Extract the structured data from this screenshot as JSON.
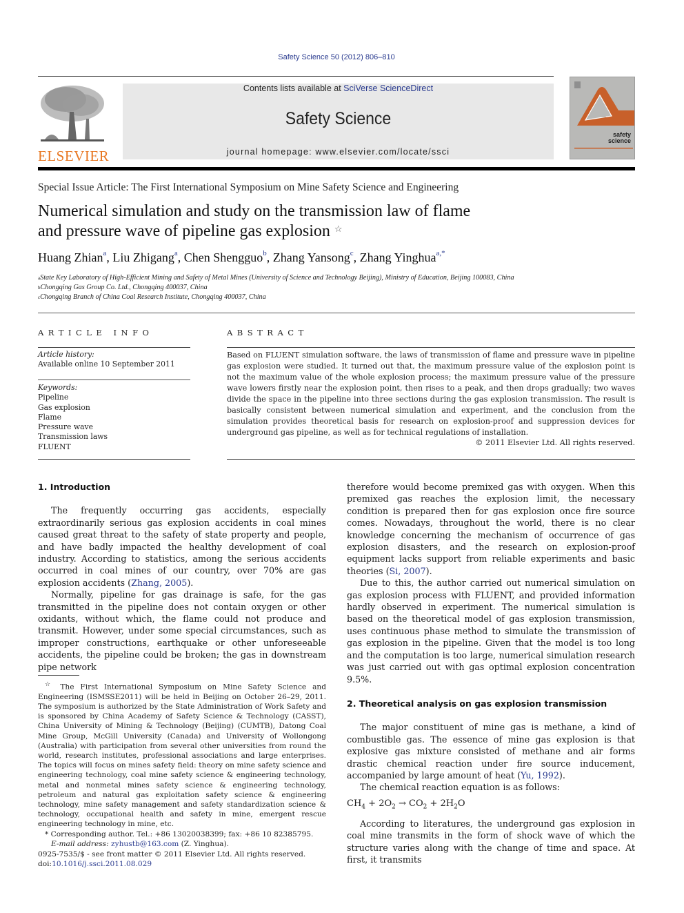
{
  "citation": "Safety Science 50 (2012) 806–810",
  "publisher": {
    "logo_text": "ELSEVIER",
    "brand_color": "#e87722"
  },
  "banner": {
    "contents_prefix": "Contents lists available at ",
    "contents_link": "SciVerse ScienceDirect",
    "journal_title": "Safety Science",
    "homepage_prefix": "journal homepage: ",
    "homepage_url": "www.elsevier.com/locate/ssci"
  },
  "cover": {
    "line1": "safety",
    "line2": "science",
    "accent_color": "#c8602a"
  },
  "article": {
    "special_issue": "Special Issue Article: The First International Symposium on Mine Safety Science and Engineering",
    "title_line1": "Numerical simulation and study on the transmission law of flame",
    "title_line2": "and pressure wave of pipeline gas explosion",
    "title_mark": "☆",
    "authors": [
      {
        "name": "Huang Zhian",
        "sup": "a"
      },
      {
        "name": "Liu Zhigang",
        "sup": "a"
      },
      {
        "name": "Chen Shengguo",
        "sup": "b"
      },
      {
        "name": "Zhang Yansong",
        "sup": "c"
      },
      {
        "name": "Zhang Yinghua",
        "sup": "a,*"
      }
    ],
    "affiliations": [
      {
        "sup": "a",
        "text": "State Key Laboratory of High-Efficient Mining and Safety of Metal Mines (University of Science and Technology Beijing), Ministry of Education, Beijing 100083, China"
      },
      {
        "sup": "b",
        "text": "Chongqing Gas Group Co. Ltd., Chongqing 400037, China"
      },
      {
        "sup": "c",
        "text": "Chongqing Branch of China Coal Research Institute, Chongqing 400037, China"
      }
    ]
  },
  "article_info": {
    "heading": "ARTICLE INFO",
    "history_label": "Article history:",
    "history_value": "Available online 10 September 2011",
    "keywords_label": "Keywords:",
    "keywords": [
      "Pipeline",
      "Gas explosion",
      "Flame",
      "Pressure wave",
      "Transmission laws",
      "FLUENT"
    ]
  },
  "abstract": {
    "heading": "ABSTRACT",
    "text": "Based on FLUENT simulation software, the laws of transmission of flame and pressure wave in pipeline gas explosion were studied. It turned out that, the maximum pressure value of the explosion point is not the maximum value of the whole explosion process; the maximum pressure value of the pressure wave lowers firstly near the explosion point, then rises to a peak, and then drops gradually; two waves divide the space in the pipeline into three sections during the gas explosion transmission. The result is basically consistent between numerical simulation and experiment, and the conclusion from the simulation provides theoretical basis for research on explosion-proof and suppression devices for underground gas pipeline, as well as for technical regulations of installation.",
    "copyright": "© 2011 Elsevier Ltd. All rights reserved."
  },
  "body": {
    "sec1_heading": "1. Introduction",
    "sec1_p1_pre": "The frequently occurring gas accidents, especially extraordinarily serious gas explosion accidents in coal mines caused great threat to the safety of state property and people, and have badly impacted the healthy development of coal industry. According to statistics, among the serious accidents occurred in coal mines of our country, over 70% are gas explosion accidents (",
    "sec1_p1_ref": "Zhang, 2005",
    "sec1_p1_post": ").",
    "sec1_p2": "Normally, pipeline for gas drainage is safe, for the gas transmitted in the pipeline does not contain oxygen or other oxidants, without which, the flame could not produce and transmit. However, under some special circumstances, such as improper constructions, earthquake or other unforeseeable accidents, the pipeline could be broken; the gas in downstream pipe network",
    "col2_p1_pre": "therefore would become premixed gas with oxygen. When this premixed gas reaches the explosion limit, the necessary condition is prepared then for gas explosion once fire source comes. Nowadays, throughout the world, there is no clear knowledge concerning the mechanism of occurrence of gas explosion disasters, and the research on explosion-proof equipment lacks support from reliable experiments and basic theories (",
    "col2_p1_ref": "Si, 2007",
    "col2_p1_post": ").",
    "col2_p2": "Due to this, the author carried out numerical simulation on gas explosion process with FLUENT, and provided information hardly observed in experiment. The numerical simulation is based on the theoretical model of gas explosion transmission, uses continuous phase method to simulate the transmission of gas explosion in the pipeline. Given that the model is too long and the computation is too large, numerical simulation research was just carried out with gas optimal explosion concentration 9.5%.",
    "sec2_heading": "2. Theoretical analysis on gas explosion transmission",
    "sec2_p1_pre": "The major constituent of mine gas is methane, a kind of combustible gas. The essence of mine gas explosion is that explosive gas mixture consisted of methane and air forms drastic chemical reaction under fire source inducement, accompanied by large amount of heat (",
    "sec2_p1_ref": "Yu, 1992",
    "sec2_p1_post": ").",
    "sec2_p2": "The chemical reaction equation is as follows:",
    "equation": {
      "r1": "CH",
      "r1_sub": "4",
      "plus1": " + 2O",
      "r2_sub": "2",
      "arrow": " → CO",
      "p1_sub": "2",
      "plus2": " + 2H",
      "p2_sub": "2",
      "tail": "O"
    },
    "sec2_p3": "According to literatures, the underground gas explosion in coal mine transmits in the form of shock wave of which the structure varies along with the change of time and space. At first, it transmits"
  },
  "footnotes": {
    "star_mark": "☆",
    "star_text": "The First International Symposium on Mine Safety Science and Engineering (ISMSSE2011) will be held in Beijing on October 26–29, 2011. The symposium is authorized by the State Administration of Work Safety and is sponsored by China Academy of Safety Science & Technology (CASST), China University of Mining & Technology (Beijing) (CUMTB), Datong Coal Mine Group, McGill University (Canada) and University of Wollongong (Australia) with participation from several other universities from round the world, research institutes, professional associations and large enterprises. The topics will focus on mines safety field: theory on mine safety science and engineering technology, coal mine safety science & engineering technology, metal and nonmetal mines safety science & engineering technology, petroleum and natural gas exploitation safety science & engineering technology, mine safety management and safety standardization science & technology, occupational health and safety in mine, emergent rescue engineering technology in mine, etc.",
    "corr_mark": "*",
    "corr_text": "Corresponding author. Tel.: +86 13020038399; fax: +86 10 82385795.",
    "email_label": "E-mail address:",
    "email": "zyhustb@163.com",
    "email_suffix": " (Z. Yinghua)."
  },
  "bottom": {
    "issn": "0925-7535/$ - see front matter © 2011 Elsevier Ltd. All rights reserved.",
    "doi_label": "doi:",
    "doi": "10.1016/j.ssci.2011.08.029"
  }
}
